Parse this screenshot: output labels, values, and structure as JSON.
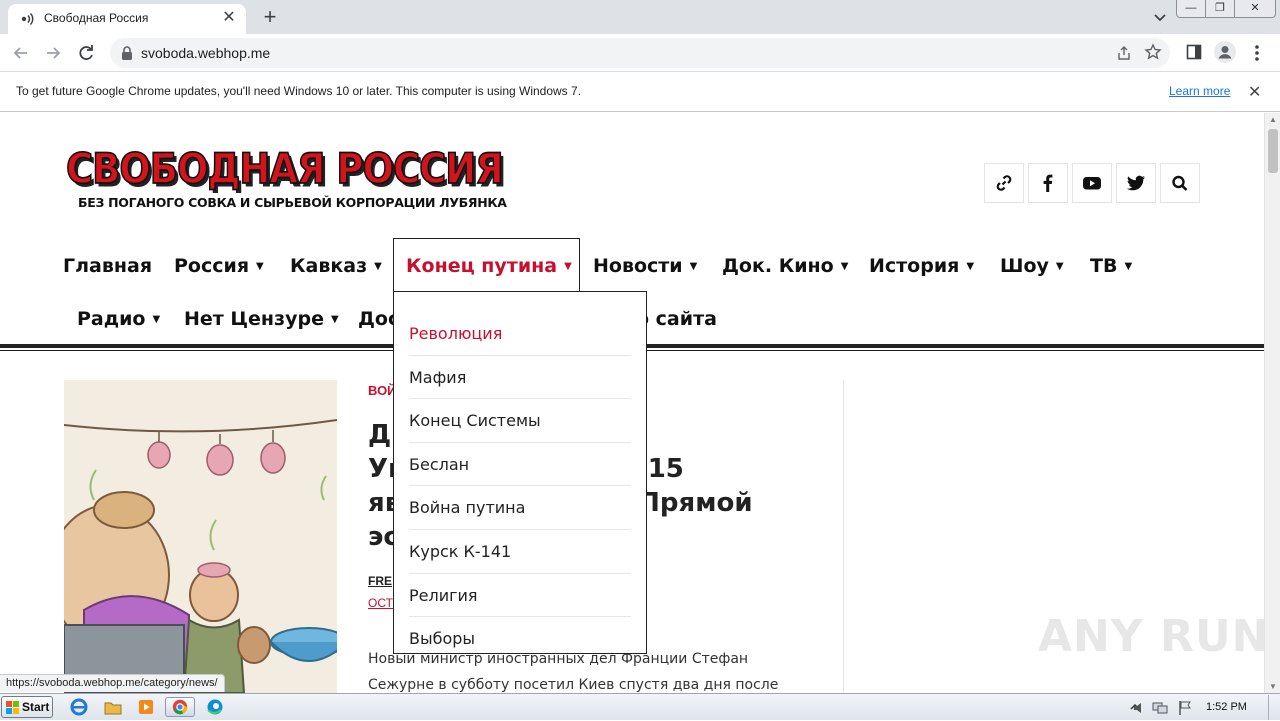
{
  "browser": {
    "tab_title": "Свободная Россия",
    "new_tab_symbol": "+",
    "tab_close_symbol": "✕",
    "url": "svoboda.webhop.me",
    "window_controls": [
      "—",
      "❐",
      "✕"
    ]
  },
  "infobar": {
    "message": "To get future Google Chrome updates, you'll need Windows 10 or later. This computer is using Windows 7.",
    "link": "Learn more",
    "close_symbol": "✕"
  },
  "site": {
    "logo_title": "СВОБОДНАЯ РОССИЯ",
    "logo_subtitle": "БЕЗ ПОГАНОГО СОВКА И СЫРЬЕВОЙ КОРПОРАЦИИ ЛУБЯНКА",
    "social_icons": [
      "link-icon",
      "facebook-icon",
      "youtube-icon",
      "twitter-icon",
      "search-icon"
    ],
    "accent_color": "#c8102e",
    "nav": [
      {
        "label": "Главная"
      },
      {
        "label": "Россия",
        "arrow": "▼"
      },
      {
        "label": "Кавказ",
        "arrow": "▼"
      },
      {
        "label": "Конец путина",
        "arrow": "▼",
        "active": true
      },
      {
        "label": "Новости",
        "arrow": "▼"
      },
      {
        "label": "Док. Кино",
        "arrow": "▼"
      },
      {
        "label": "История",
        "arrow": "▼"
      },
      {
        "label": "Шоу",
        "arrow": "▼"
      },
      {
        "label": "ТВ",
        "arrow": "▼"
      },
      {
        "label": "Радио",
        "arrow": "▼"
      },
      {
        "label": "Нет Цензуре",
        "arrow": "▼"
      },
      {
        "label": "Дос"
      },
      {
        "label": "о сайта"
      }
    ],
    "dropdown": [
      "Революция",
      "Мафия",
      "Конец Системы",
      "Беслан",
      "Война путина",
      "Курск К-141",
      "Религия",
      "Выборы"
    ],
    "article": {
      "category": "ВОЙ",
      "title_lines": [
        "Д",
        "Ук",
        "15",
        "яв",
        "Прямой",
        "эс"
      ],
      "author": "FRE",
      "comments": "ОСТ",
      "excerpt_lines": [
        "Новый министр иностранных дел Франции Стефан",
        "Сежурне в субботу посетил Киев спустя два дня после"
      ]
    }
  },
  "status_url": "https://svoboda.webhop.me/category/news/",
  "watermark": "ANY RUN",
  "taskbar": {
    "start_label": "Start",
    "clock": "1:52 PM"
  }
}
